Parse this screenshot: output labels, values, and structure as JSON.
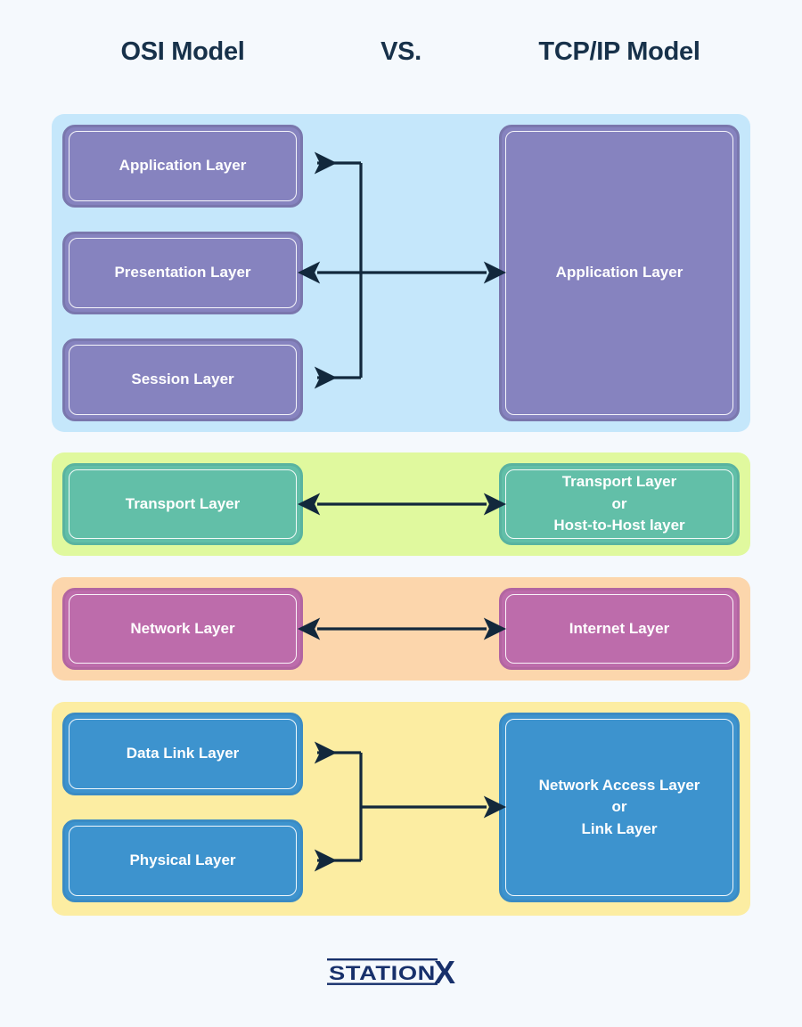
{
  "headers": {
    "left": "OSI Model",
    "middle": "VS.",
    "right": "TCP/IP Model"
  },
  "colors": {
    "page_background": "#f5f9fd",
    "title_text": "#17314a",
    "arrow": "#12283c",
    "band_application": "#c5e7fb",
    "band_transport": "#e0f99e",
    "band_network": "#fcd6ac",
    "band_link": "#fceda2",
    "box_purple": "#8683bf",
    "box_teal": "#62bfa8",
    "box_orchid": "#bd6cab",
    "box_blue": "#3d93ce",
    "box_text": "#ffffff",
    "logo": "#17306b"
  },
  "groups": [
    {
      "id": "application-group",
      "band_color": "#c5e7fb",
      "osi_layers": [
        {
          "id": "application-layer",
          "label": "Application Layer"
        },
        {
          "id": "presentation-layer",
          "label": "Presentation Layer"
        },
        {
          "id": "session-layer",
          "label": "Session Layer"
        }
      ],
      "tcp_layers": [
        {
          "id": "tcp-application-layer",
          "label": "Application Layer"
        }
      ],
      "connector": "branched-three-to-one"
    },
    {
      "id": "transport-group",
      "band_color": "#e0f99e",
      "osi_layers": [
        {
          "id": "transport-layer",
          "label": "Transport Layer"
        }
      ],
      "tcp_layers": [
        {
          "id": "tcp-transport-layer",
          "label": "Transport Layer or Host-to-Host layer",
          "line1": "Transport Layer",
          "line2": "or",
          "line3": "Host-to-Host layer"
        }
      ],
      "connector": "double-arrow"
    },
    {
      "id": "network-group",
      "band_color": "#fcd6ac",
      "osi_layers": [
        {
          "id": "network-layer",
          "label": "Network Layer"
        }
      ],
      "tcp_layers": [
        {
          "id": "internet-layer",
          "label": "Internet Layer"
        }
      ],
      "connector": "double-arrow"
    },
    {
      "id": "link-group",
      "band_color": "#fceda2",
      "osi_layers": [
        {
          "id": "data-link-layer",
          "label": "Data Link Layer"
        },
        {
          "id": "physical-layer",
          "label": "Physical Layer"
        }
      ],
      "tcp_layers": [
        {
          "id": "network-access-layer",
          "label": "Network Access Layer or Link Layer",
          "line1": "Network Access Layer",
          "line2": "or",
          "line3": "Link Layer"
        }
      ],
      "connector": "branched-two-to-one"
    }
  ],
  "logo": {
    "word": "STATION",
    "mark": "X",
    "alt": "StationX logo"
  }
}
